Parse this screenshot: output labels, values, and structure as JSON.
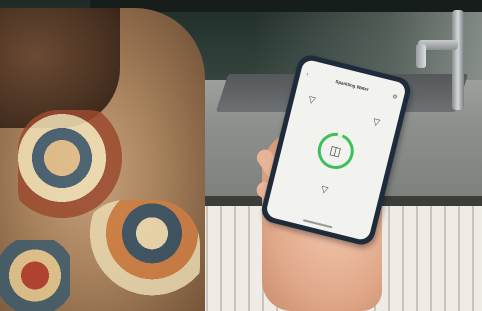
{
  "scene": {
    "description_colors": {
      "wall": "#2b3a35",
      "counter": "#8c8f8b",
      "cabinet": "#efece6",
      "phone_frame": "#1e2b3a",
      "ring": "#3dbf5a"
    }
  },
  "app": {
    "title": "Sparkling Water",
    "back_icon": "chevron-left-icon",
    "settings_icon": "gear-icon",
    "center_icon": "glass-sparkling-icon",
    "option_icons": [
      "glass-icon",
      "glass-icon",
      "glass-icon"
    ]
  }
}
